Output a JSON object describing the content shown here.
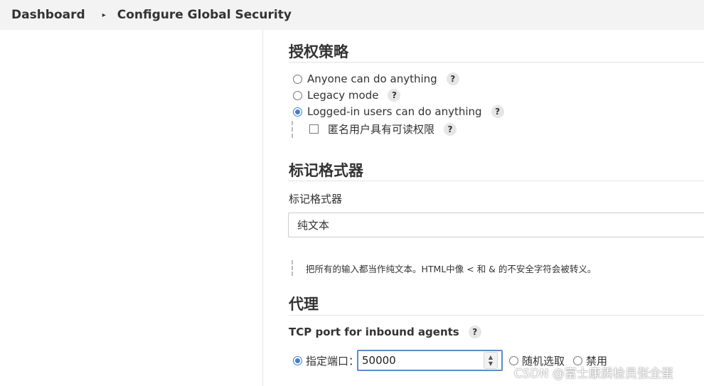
{
  "breadcrumb": {
    "items": [
      "Dashboard",
      "Configure Global Security"
    ],
    "separator": "▸"
  },
  "authorization": {
    "title": "授权策略",
    "options": [
      {
        "label": "Anyone can do anything",
        "checked": false
      },
      {
        "label": "Legacy mode",
        "checked": false
      },
      {
        "label": "Logged-in users can do anything",
        "checked": true
      }
    ],
    "anonymous_read": {
      "label": "匿名用户具有可读权限",
      "checked": false
    }
  },
  "markup_formatter": {
    "title": "标记格式器",
    "field_label": "标记格式器",
    "selected": "纯文本",
    "description": "把所有的输入都当作纯文本。HTML中像 < 和 & 的不安全字符会被转义。"
  },
  "agent": {
    "title": "代理",
    "tcp_port_label": "TCP port for inbound agents",
    "fixed_label": "指定端口：",
    "port_value": "50000",
    "random_label": "随机选取",
    "disable_label": "禁用",
    "selected": "fixed"
  },
  "help_glyph": "?",
  "watermark": "CSDN @富士康质检员张全蛋",
  "colors": {
    "accent": "#3f7fc8",
    "header_bg": "#f3f3f3"
  }
}
